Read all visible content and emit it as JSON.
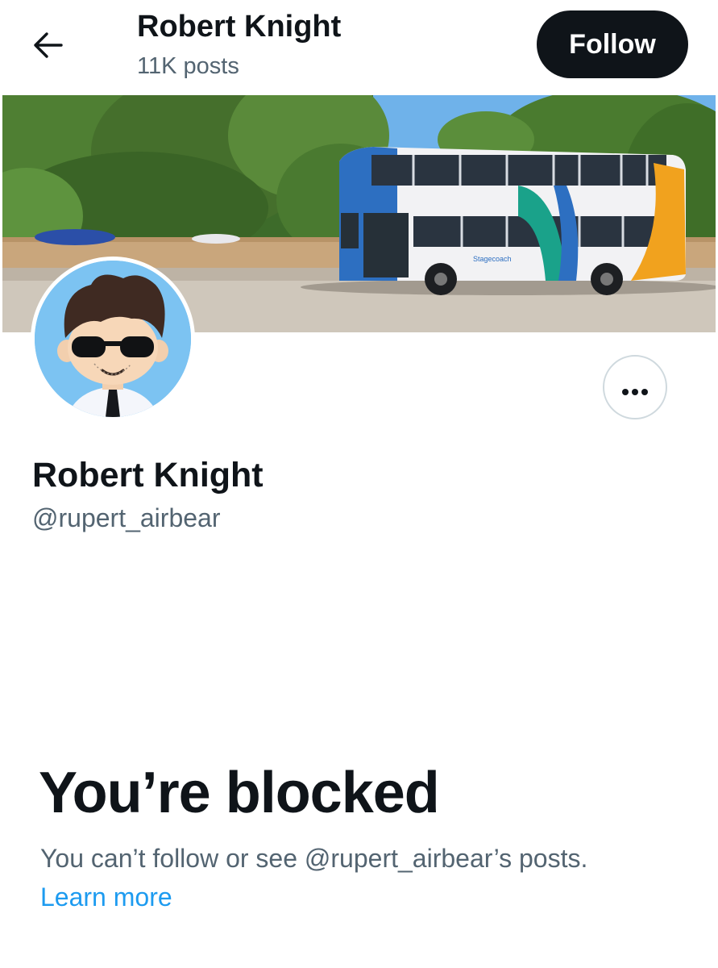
{
  "header": {
    "title": "Robert Knight",
    "posts_count": "11K posts",
    "back_icon": "arrow-left-icon",
    "follow_label": "Follow"
  },
  "banner": {
    "image": "double-decker-bus-photo",
    "bus_brand": "Stagecoach"
  },
  "profile": {
    "avatar": "cartoon-man-sunglasses-avatar",
    "name": "Robert Knight",
    "handle": "@rupert_airbear",
    "more_icon": "more-horizontal-icon"
  },
  "blocked": {
    "title": "You’re blocked",
    "description": "You can’t follow or see @rupert_airbear’s posts.",
    "learn_more": "Learn more"
  },
  "colors": {
    "text_primary": "#0f1419",
    "text_secondary": "#536471",
    "link": "#1d9bf0",
    "follow_button_bg": "#0f1419",
    "avatar_bg": "#7cc3f2"
  }
}
